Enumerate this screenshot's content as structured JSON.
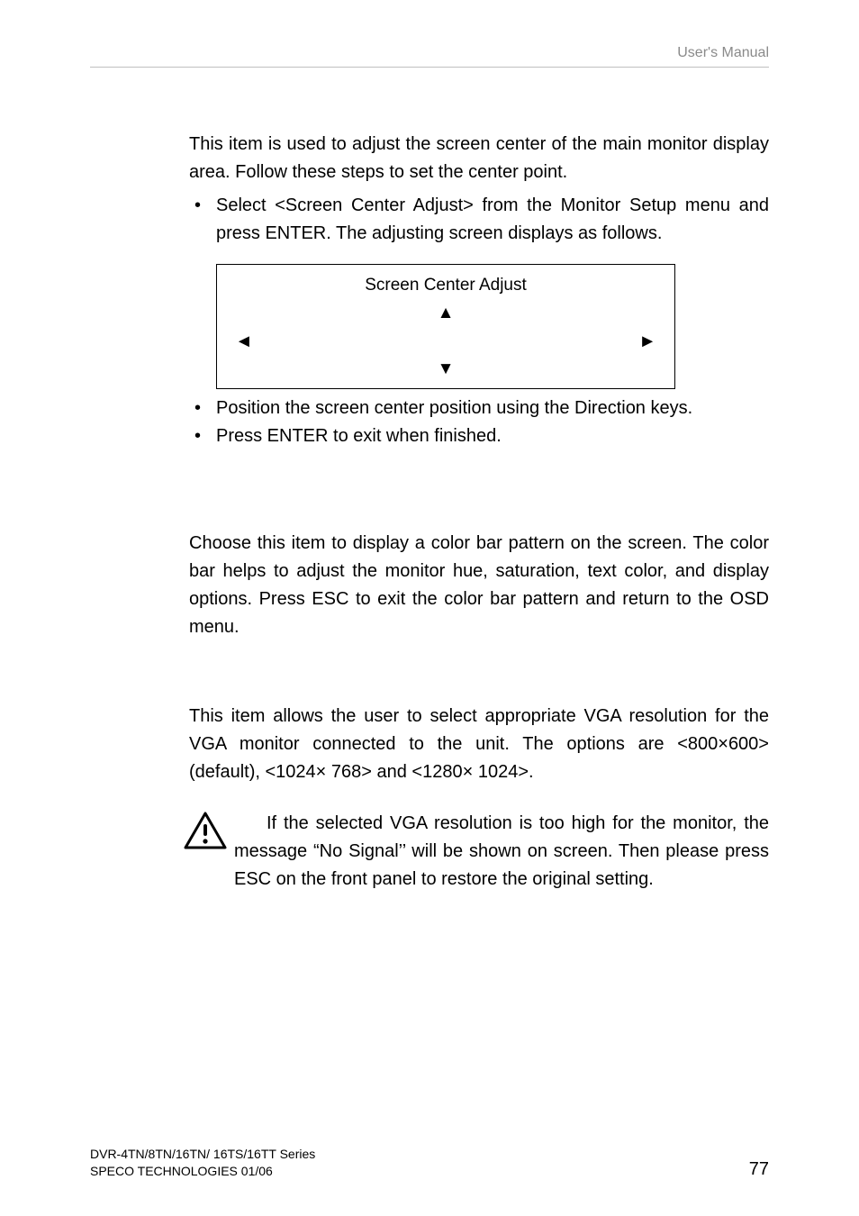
{
  "header": {
    "right": "User's Manual"
  },
  "section1": {
    "p1": "This item is used to adjust the screen center of the main monitor display area. Follow these steps to set the center point.",
    "b1": "Select <Screen Center Adjust> from the Monitor Setup menu and press ENTER. The adjusting screen displays as follows.",
    "diagram_title": "Screen Center Adjust",
    "arrow_up": "▲",
    "arrow_left": "◄",
    "arrow_right": "►",
    "arrow_down": "▼",
    "b2": "Position the screen center position using the Direction keys.",
    "b3": "Press ENTER to exit when finished."
  },
  "section2": {
    "p1": "Choose this item to display a color bar pattern on the screen. The color bar helps to adjust the monitor hue, saturation, text color, and display options. Press ESC to exit the color bar pattern and return to the OSD menu."
  },
  "section3": {
    "p1": "This item allows the user to select appropriate VGA resolution for the VGA monitor connected to the unit. The options are <800×600> (default), <1024× 768> and <1280× 1024>.",
    "note": "If the selected VGA resolution is too high for the monitor, the message “No Signal’’ will be shown on screen. Then please press ESC on the front panel to restore the original setting."
  },
  "footer": {
    "left_line1": "DVR-4TN/8TN/16TN/ 16TS/16TT Series",
    "left_line2": "SPECO TECHNOLOGIES 01/06",
    "page_no": "77"
  }
}
